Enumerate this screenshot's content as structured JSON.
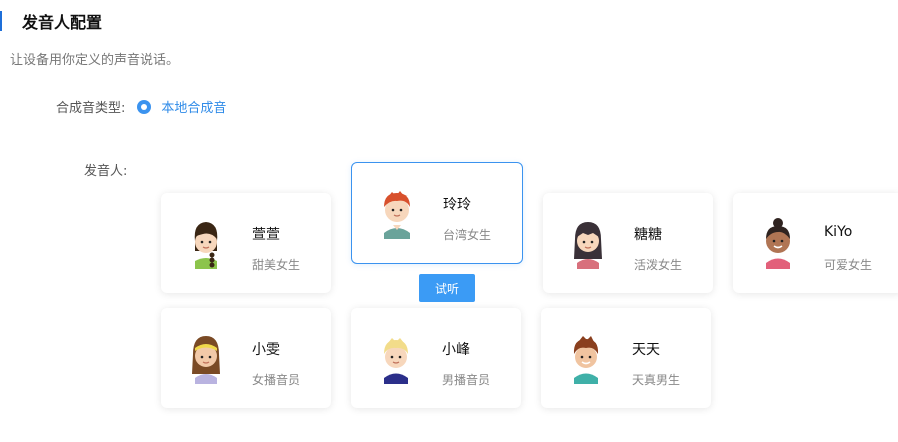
{
  "header": {
    "title": "发音人配置",
    "description": "让设备用你定义的声音说话。"
  },
  "synth_type": {
    "label": "合成音类型:",
    "option": "本地合成音"
  },
  "speaker": {
    "label": "发音人:",
    "try_label": "试听",
    "cards": [
      {
        "name": "萱萱",
        "desc": "甜美女生"
      },
      {
        "name": "玲玲",
        "desc": "台湾女生",
        "selected": true
      },
      {
        "name": "糖糖",
        "desc": "活泼女生"
      },
      {
        "name": "KiYo",
        "desc": "可爱女生"
      },
      {
        "name": "小雯",
        "desc": "女播音员"
      },
      {
        "name": "小峰",
        "desc": "男播音员"
      },
      {
        "name": "天天",
        "desc": "天真男生"
      }
    ]
  },
  "colors": {
    "accent": "#3b93ef",
    "title_bar": "#1e6fd9"
  }
}
